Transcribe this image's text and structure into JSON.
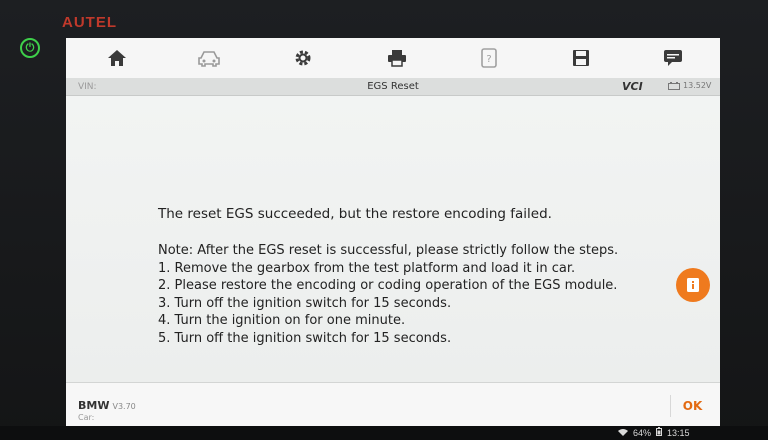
{
  "device": {
    "brand": "AUTEL"
  },
  "toolbar": {
    "icons": [
      "home-icon",
      "car-icon",
      "gear-icon",
      "printer-icon",
      "help-doc-icon",
      "save-icon",
      "message-icon"
    ]
  },
  "infobar": {
    "vin_label": "VIN:",
    "title": "EGS Reset",
    "vci_label": "VCI",
    "battery_voltage": "13.52V"
  },
  "message": {
    "main": "The reset EGS succeeded, but the restore encoding failed.",
    "note_lines": [
      "Note: After the EGS reset is successful, please strictly follow the steps.",
      "1. Remove the gearbox from the test platform and load it in car.",
      "2. Please restore the encoding or coding operation of the EGS module.",
      "3. Turn off the ignition switch for 15 seconds.",
      "4. Turn the ignition on for one minute.",
      "5. Turn off the ignition switch for 15 seconds."
    ]
  },
  "footer": {
    "vehicle_make": "BMW",
    "vehicle_version": "V3.70",
    "car_label": "Car:",
    "ok_label": "OK"
  },
  "statusbar": {
    "battery": "64%",
    "time": "13:15"
  },
  "colors": {
    "accent": "#ef7a1e",
    "ok_text": "#e36a12",
    "brand_red": "#c0392b",
    "power_green": "#3ecf4a"
  }
}
